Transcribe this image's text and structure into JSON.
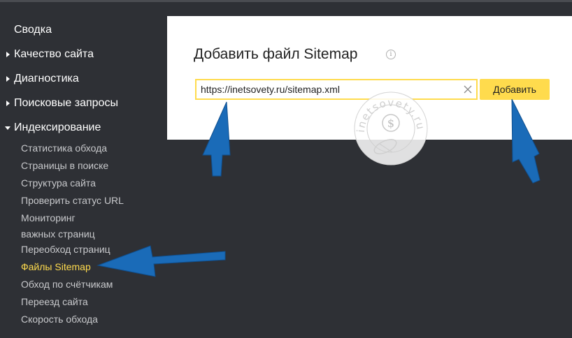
{
  "sidebar": {
    "top_items": [
      {
        "label": "Сводка"
      },
      {
        "label": "Качество сайта"
      },
      {
        "label": "Диагностика"
      },
      {
        "label": "Поисковые запросы"
      },
      {
        "label": "Индексирование"
      }
    ],
    "sub_items": [
      {
        "label": "Статистика обхода"
      },
      {
        "label": "Страницы в поиске"
      },
      {
        "label": "Структура сайта"
      },
      {
        "label": "Проверить статус URL"
      },
      {
        "label_line1": "Мониторинг",
        "label_line2": "важных страниц"
      },
      {
        "label": "Переобход страниц"
      },
      {
        "label": "Файлы Sitemap"
      },
      {
        "label": "Обход по счётчикам"
      },
      {
        "label": "Переезд сайта"
      },
      {
        "label": "Скорость обхода"
      }
    ]
  },
  "main": {
    "title": "Добавить файл Sitemap",
    "info_icon": "i",
    "input_value": "https://inetsovety.ru/sitemap.xml",
    "add_button_label": "Добавить"
  },
  "watermark": {
    "text": "inetsovety.ru",
    "symbol": "$"
  },
  "colors": {
    "background": "#2e3035",
    "accent": "#ffdb4d",
    "active_nav": "#ffdb4d",
    "arrow": "#1a6bb8"
  }
}
